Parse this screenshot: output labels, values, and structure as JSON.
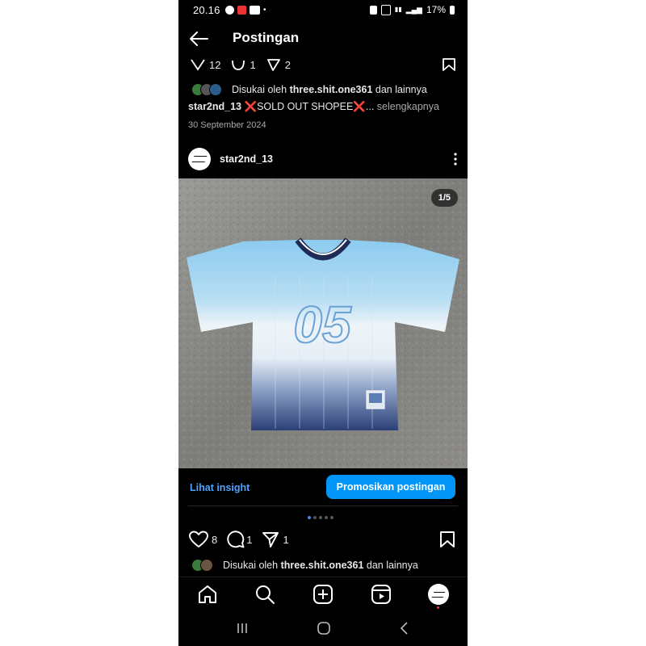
{
  "status": {
    "time": "20.16",
    "battery": "17%"
  },
  "header": {
    "title": "Postingan"
  },
  "prev_post": {
    "likes": "12",
    "comments": "1",
    "shares": "2",
    "liked_by_prefix": "Disukai oleh ",
    "liked_by_user": "three.shit.one361",
    "liked_by_suffix": " dan lainnya",
    "caption_user": "star2nd_13",
    "caption_text": "❌SOLD OUT SHOPEE❌...",
    "more": "selengkapnya",
    "date": "30 September 2024"
  },
  "post": {
    "username": "star2nd_13",
    "carousel_counter": "1/5",
    "jersey_number": "05",
    "insight_label": "Lihat insight",
    "promote_label": "Promosikan postingan",
    "likes": "8",
    "comments": "1",
    "shares": "1",
    "liked_by_prefix": "Disukai oleh ",
    "liked_by_user": "three.shit.one361",
    "liked_by_suffix": " dan lainnya"
  },
  "colors": {
    "accent": "#0095f6",
    "link": "#4da3ff",
    "background": "#000000",
    "jersey_light": "#8ccbf0",
    "jersey_dark": "#2b3f78"
  }
}
